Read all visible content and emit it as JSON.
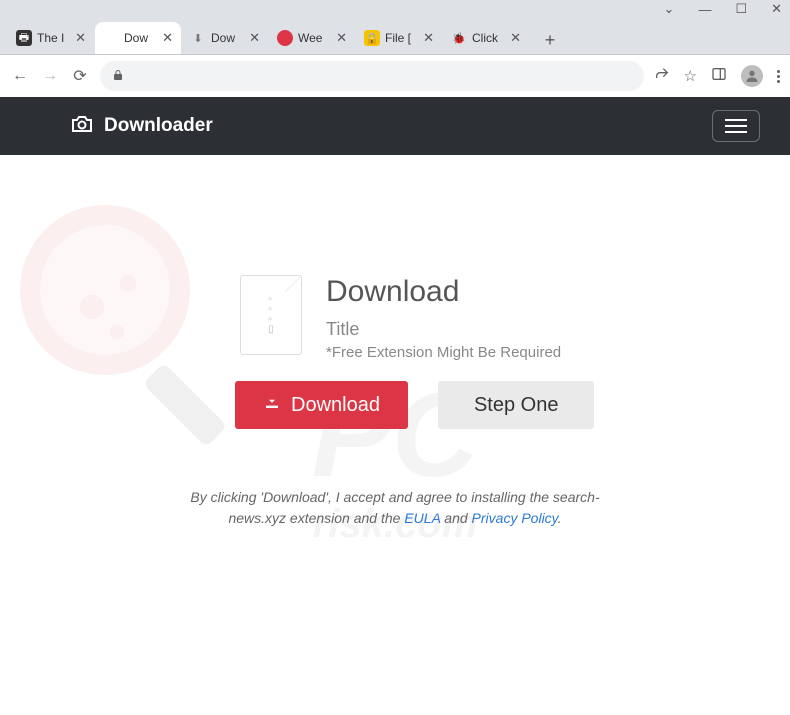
{
  "window": {
    "chevron": "⌄",
    "minimize": "—",
    "maximize": "☐",
    "close": "✕"
  },
  "tabs": [
    {
      "title": "The I",
      "favicon_name": "printer-icon"
    },
    {
      "title": "Dow",
      "favicon_name": "generic-icon"
    },
    {
      "title": "Dow",
      "favicon_name": "download-icon"
    },
    {
      "title": "Wee",
      "favicon_name": "red-circle-icon"
    },
    {
      "title": "File [",
      "favicon_name": "lock-yellow-icon"
    },
    {
      "title": "Click",
      "favicon_name": "ladybug-icon"
    }
  ],
  "new_tab": "+",
  "tab_close": "✕",
  "toolbar": {
    "back": "←",
    "forward": "→",
    "reload": "⟳",
    "share": "↗",
    "star": "☆",
    "panel": "▣",
    "menu": "⋮"
  },
  "brand": "Downloader",
  "page": {
    "heading": "Download",
    "title_line": "Title",
    "note": "*Free Extension Might Be Required",
    "download_btn": "Download",
    "step_btn": "Step One"
  },
  "disclaimer": {
    "prefix": "By clicking 'Download', I accept and agree to installing the search-news.xyz extension and the ",
    "eula": "EULA",
    "and": " and ",
    "privacy": "Privacy Policy",
    "suffix": "."
  },
  "watermark": {
    "main": "PC",
    "sub": "risk.com"
  }
}
